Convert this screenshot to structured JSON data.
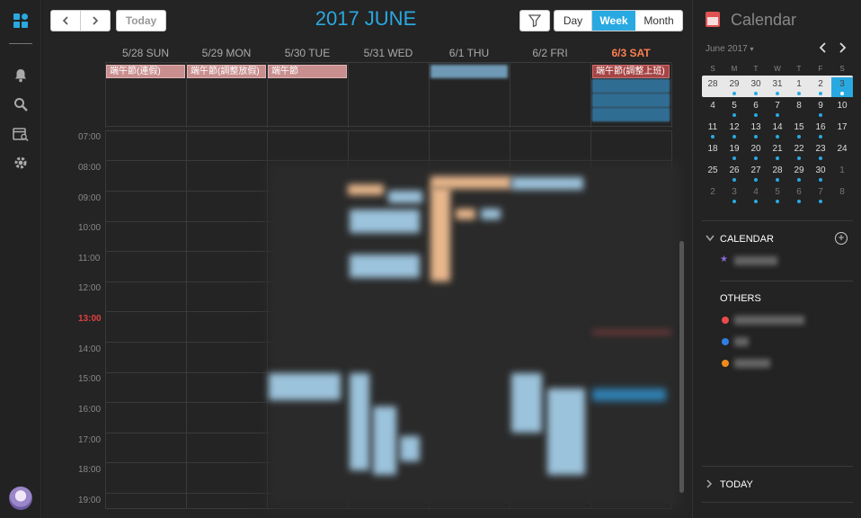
{
  "window": {
    "app_title": "Calendar"
  },
  "toolbar": {
    "prev_icon": "chevron-left-icon",
    "next_icon": "chevron-right-icon",
    "today_label": "Today",
    "title": "2017 JUNE",
    "filter_icon": "filter-icon",
    "views": [
      {
        "label": "Day",
        "active": false
      },
      {
        "label": "Week",
        "active": true
      },
      {
        "label": "Month",
        "active": false
      }
    ]
  },
  "week": {
    "days": [
      {
        "label": "5/28 SUN"
      },
      {
        "label": "5/29 MON"
      },
      {
        "label": "5/30 TUE"
      },
      {
        "label": "5/31 WED"
      },
      {
        "label": "6/1 THU"
      },
      {
        "label": "6/2 FRI"
      },
      {
        "label": "6/3 SAT"
      }
    ],
    "allday_events": [
      {
        "day": 0,
        "label": "端午節(連假)",
        "style": "pink"
      },
      {
        "day": 1,
        "label": "端午節(調整放假)",
        "style": "pink"
      },
      {
        "day": 2,
        "label": "端午節",
        "style": "pink"
      },
      {
        "day": 6,
        "label": "端午節(調整上班)",
        "style": "red"
      }
    ],
    "hours": [
      "07:00",
      "08:00",
      "09:00",
      "10:00",
      "11:00",
      "12:00",
      "13:00",
      "14:00",
      "15:00",
      "16:00",
      "17:00",
      "18:00",
      "19:00"
    ],
    "current_hour": "13:00"
  },
  "sidebar": {
    "title": "Calendar",
    "month_label": "June 2017",
    "weekday_headers": [
      "S",
      "M",
      "T",
      "W",
      "T",
      "F",
      "S"
    ],
    "weeks": [
      [
        28,
        29,
        30,
        31,
        1,
        2,
        3
      ],
      [
        4,
        5,
        6,
        7,
        8,
        9,
        10
      ],
      [
        11,
        12,
        13,
        14,
        15,
        16,
        17
      ],
      [
        18,
        19,
        20,
        21,
        22,
        23,
        24
      ],
      [
        25,
        26,
        27,
        28,
        29,
        30,
        1
      ],
      [
        2,
        3,
        4,
        5,
        6,
        7,
        8
      ]
    ],
    "selected_day": 3,
    "calendar_section": "CALENDAR",
    "others_section": "OTHERS",
    "today_section": "TODAY",
    "others_colors": [
      "#e84b4b",
      "#2e7fe0",
      "#f08a1c"
    ]
  }
}
